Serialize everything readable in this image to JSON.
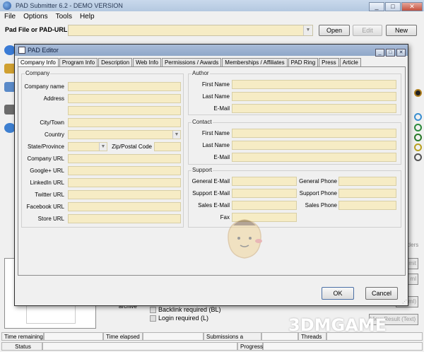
{
  "window": {
    "title": "PAD Submitter 6.2 - DEMO VERSION",
    "min": "_",
    "max": "□",
    "close": "✕"
  },
  "menu": {
    "items": [
      "File",
      "Options",
      "Tools",
      "Help"
    ]
  },
  "pad_url": {
    "label": "Pad File or PAD-URL",
    "value": "",
    "open": "Open",
    "edit": "Edit",
    "new": "New"
  },
  "right_panel": {
    "labels": [
      "e",
      "y",
      "s",
      "s",
      "it"
    ],
    "submit": "mit",
    "stop": "ml",
    "btn3": "(xml)",
    "view_result": "View Result (Text)",
    "orders": "rders"
  },
  "bottom": {
    "archive_label": "archive",
    "backlink": "Backlink required (BL)",
    "login": "Login required (L)"
  },
  "status": {
    "time_remaining": "Time remaining",
    "time_elapsed": "Time elapsed",
    "submissions": "Submissions a minute",
    "threads": "Threads",
    "status": "Status",
    "progress": "Progress"
  },
  "dialog": {
    "title": "PAD Editor",
    "tabs": [
      "Company Info",
      "Program Info",
      "Description",
      "Web Info",
      "Permissions / Awards",
      "Memberships / Affiliates",
      "PAD Ring",
      "Press",
      "Article"
    ],
    "company": {
      "title": "Company",
      "labels": {
        "name": "Company name",
        "address": "Address",
        "city": "City/Town",
        "country": "Country",
        "state": "State/Province",
        "zip": "Zip/Postal Code",
        "url": "Company URL",
        "google": "Google+ URL",
        "linkedin": "LinkedIn URL",
        "twitter": "Twitter URL",
        "facebook": "Facebook URL",
        "store": "Store URL"
      }
    },
    "author": {
      "title": "Author",
      "first": "First Name",
      "last": "Last Name",
      "email": "E-Mail"
    },
    "contact": {
      "title": "Contact",
      "first": "First Name",
      "last": "Last Name",
      "email": "E-Mail"
    },
    "support": {
      "title": "Support",
      "general_email": "General E-Mail",
      "general_phone": "General Phone",
      "support_email": "Support E-Mail",
      "support_phone": "Support Phone",
      "sales_email": "Sales E-Mail",
      "sales_phone": "Sales Phone",
      "fax": "Fax"
    },
    "ok": "OK",
    "cancel": "Cancel"
  },
  "watermark": "3DMGAME",
  "colors": {
    "field_bg": "#f6ecc5",
    "title_bar": "#b4c8e0"
  }
}
